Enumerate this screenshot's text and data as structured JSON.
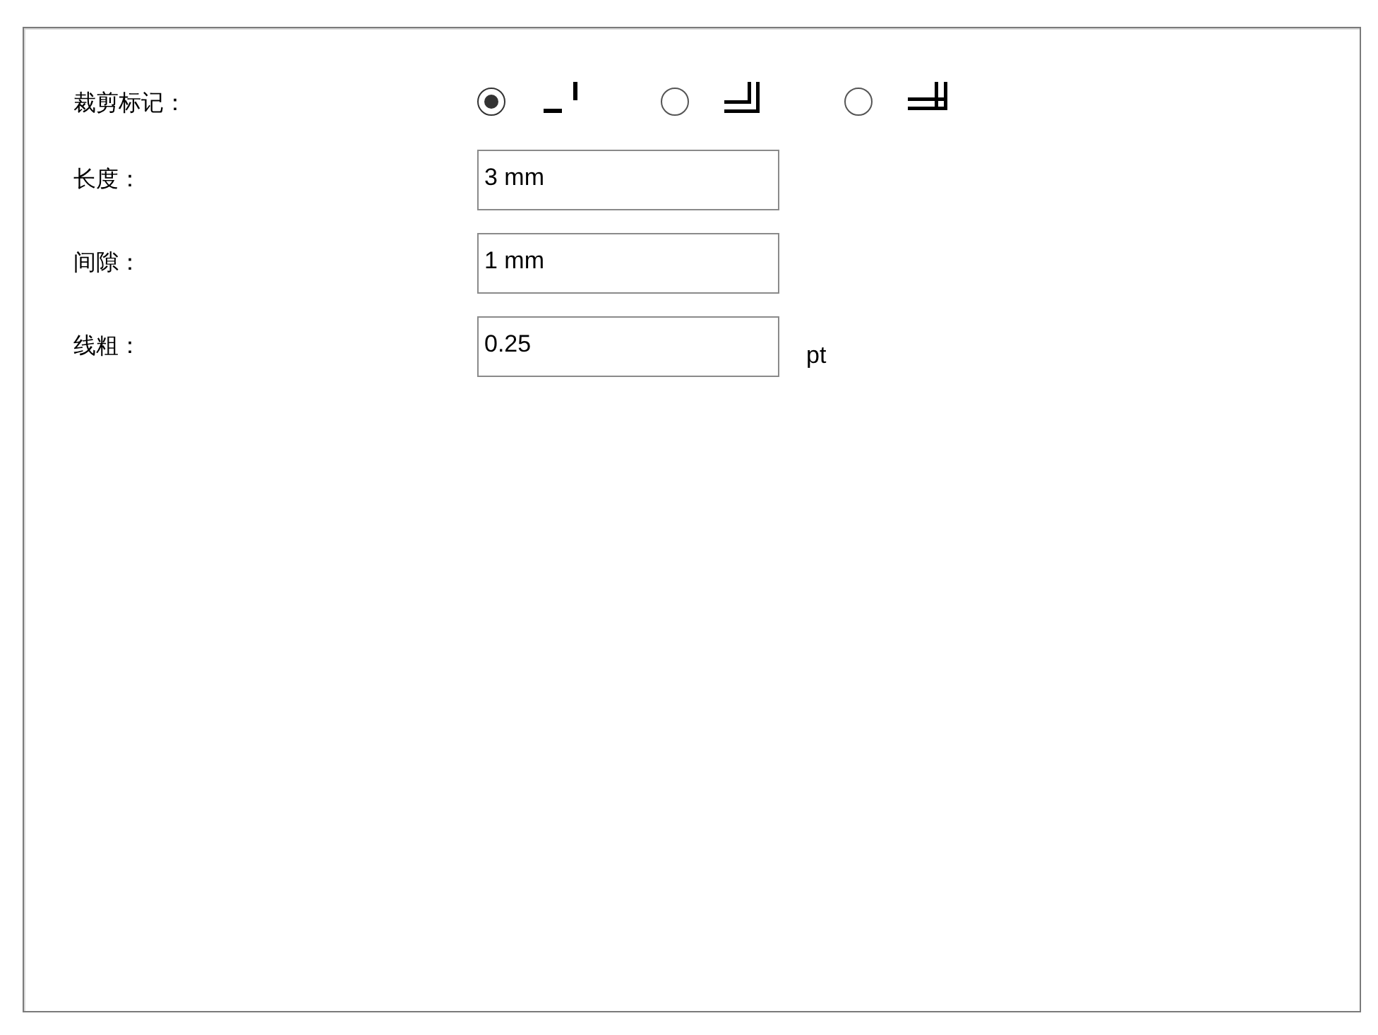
{
  "crop_marks": {
    "label": "裁剪标记：",
    "options": [
      {
        "selected": true,
        "kind": "single"
      },
      {
        "selected": false,
        "kind": "double"
      },
      {
        "selected": false,
        "kind": "crossed"
      }
    ]
  },
  "fields": [
    {
      "label": "长度：",
      "value": "3 mm"
    },
    {
      "label": "间隙：",
      "value": "1 mm"
    },
    {
      "label": "线粗：",
      "value": "0.25",
      "unit": "pt"
    }
  ]
}
